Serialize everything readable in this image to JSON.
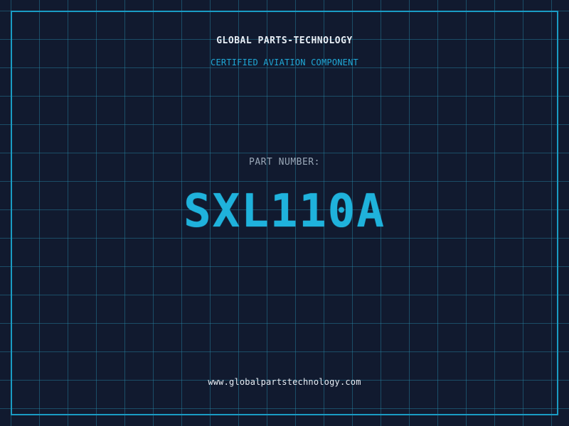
{
  "brand": {
    "name": "GLOBAL PARTS-TECHNOLOGY",
    "tagline": "CERTIFIED AVIATION COMPONENT"
  },
  "part": {
    "label": "PART NUMBER:",
    "number": "SXL110A"
  },
  "footer": {
    "website": "www.globalpartstechnology.com"
  },
  "colors": {
    "background": "#111a2f",
    "grid": "#288caa",
    "accent": "#1fb2dc",
    "text": "#e8eef5",
    "muted": "#9aa8b8"
  }
}
